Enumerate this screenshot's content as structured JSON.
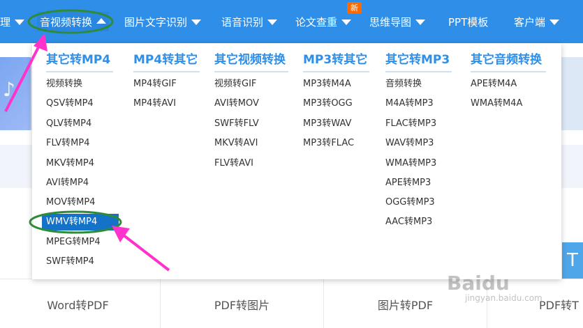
{
  "nav": {
    "items": [
      {
        "label": "理",
        "caret": true
      },
      {
        "label": "音视频转换",
        "caret": true,
        "active": true
      },
      {
        "label": "图片文字识别",
        "caret": true
      },
      {
        "label": "语音识别",
        "caret": true
      },
      {
        "label": "论文查重",
        "caret": true,
        "badge": "新"
      },
      {
        "label": "思维导图",
        "caret": true
      },
      {
        "label": "PPT模板",
        "caret": false
      },
      {
        "label": "客户端",
        "caret": true
      }
    ]
  },
  "dropdown": {
    "columns": [
      {
        "header": "其它转MP4",
        "items": [
          "视频转换",
          "QSV转MP4",
          "QLV转MP4",
          "FLV转MP4",
          "MKV转MP4",
          "AVI转MP4",
          "MOV转MP4",
          "WMV转MP4",
          "MPEG转MP4",
          "SWF转MP4"
        ]
      },
      {
        "header": "MP4转其它",
        "items": [
          "MP4转GIF",
          "MP4转AVI"
        ]
      },
      {
        "header": "其它视频转换",
        "items": [
          "视频转GIF",
          "AVI转MOV",
          "SWF转FLV",
          "MKV转AVI",
          "FLV转AVI"
        ]
      },
      {
        "header": "MP3转其它",
        "items": [
          "MP3转M4A",
          "MP3转OGG",
          "MP3转WAV",
          "MP3转FLAC"
        ]
      },
      {
        "header": "其它转MP3",
        "items": [
          "音频转换",
          "M4A转MP3",
          "FLAC转MP3",
          "WAV转MP3",
          "WMA转MP3",
          "APE转MP3",
          "OGG转MP3",
          "AAC转MP3"
        ]
      },
      {
        "header": "其它音频转换",
        "items": [
          "APE转M4A",
          "WMA转M4A"
        ]
      }
    ],
    "selected": "WMV转MP4"
  },
  "tools": [
    "Word转PDF",
    "PDF转图片",
    "图片转PDF",
    "PDF转T"
  ],
  "side_block_text": "T",
  "watermark": {
    "main": "Baidu",
    "sub": "jingyan.baidu.com"
  },
  "colors": {
    "nav_bg": "#2f8fe8",
    "header_text": "#2f8fe8",
    "selected_bg": "#1473c9",
    "annotation_pink": "#ff33cc",
    "annotation_green": "#2e8b3a",
    "badge": "#ff6a00"
  }
}
